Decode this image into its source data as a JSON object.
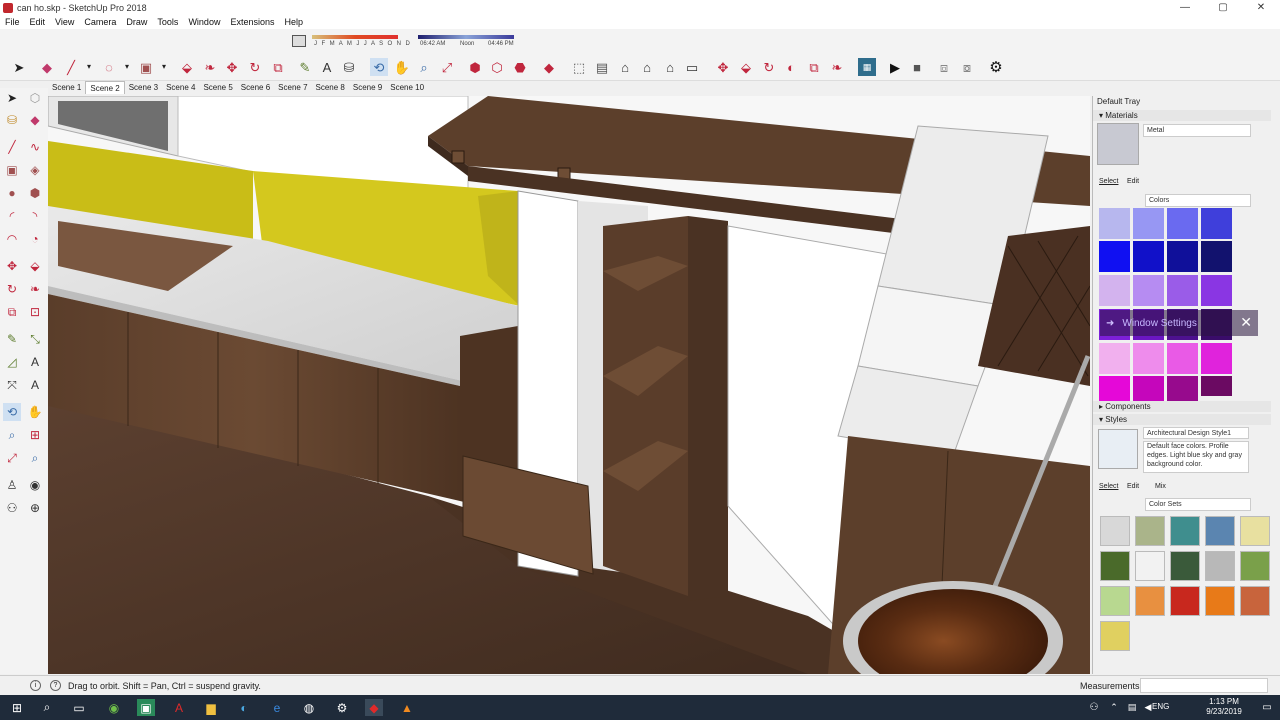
{
  "window": {
    "title": "can ho.skp - SketchUp Pro 2018",
    "controls": {
      "minimize": "—",
      "maximize": "▢",
      "close": "✕"
    }
  },
  "menu": [
    "File",
    "Edit",
    "View",
    "Camera",
    "Draw",
    "Tools",
    "Window",
    "Extensions",
    "Help"
  ],
  "shadow": {
    "months": "J F M A M J J A S O N D",
    "time_start": "06:42 AM",
    "time_mid": "Noon",
    "time_end": "04:46 PM"
  },
  "scenes": {
    "tabs": [
      "Scene 1",
      "Scene 2",
      "Scene 3",
      "Scene 4",
      "Scene 5",
      "Scene 6",
      "Scene 7",
      "Scene 8",
      "Scene 9",
      "Scene 10"
    ],
    "active_index": 1
  },
  "tray": {
    "title": "Default Tray",
    "materials": {
      "header": "Materials",
      "name_value": "Metal",
      "tabs": {
        "select": "Select",
        "edit": "Edit"
      },
      "library": "Colors",
      "swatches": [
        "#b7b7ee",
        "#9797f3",
        "#6a6af0",
        "#3f3fdb",
        "#1010f2",
        "#1111c9",
        "#10109a",
        "#12126e",
        "#d3b3ee",
        "#b68cf2",
        "#9a5ce8",
        "#8a36e3",
        "#7d1fd9",
        "#6a16c2",
        "#4d118f",
        "#3a0c6a",
        "#f1b0ee",
        "#ee8cec",
        "#e95ae6",
        "#e023dc",
        "#e508d8",
        "#c506bb",
        "#970a8d",
        "#6b0a62"
      ]
    },
    "window_settings": {
      "label": "Window Settings",
      "arrow": "➜",
      "close": "✕"
    },
    "components": {
      "header": "Components"
    },
    "styles": {
      "header": "Styles",
      "name_value": "Architectural Design Style1",
      "description": "Default face colors. Profile edges. Light blue sky and gray background color.",
      "tabs": {
        "select": "Select",
        "edit": "Edit",
        "mix": "Mix"
      },
      "library": "Color Sets",
      "tiles": [
        "#d8d8d8",
        "#aab48a",
        "#3f8e8e",
        "#5b85b0",
        "#e8e0a0",
        "#4a6a2a",
        "#f2f2f2",
        "#3a5a3a",
        "#b8b8b8",
        "#7aa04a",
        "#b8d890",
        "#e89040",
        "#c8281e",
        "#e87a18",
        "#c8643c",
        "#e0d060"
      ]
    }
  },
  "status": {
    "hint": "Drag to orbit. Shift = Pan, Ctrl = suspend gravity.",
    "measurements_label": "Measurements",
    "measurements_value": ""
  },
  "taskbar": {
    "language": "ENG",
    "time": "1:13 PM",
    "date": "9/23/2019"
  }
}
